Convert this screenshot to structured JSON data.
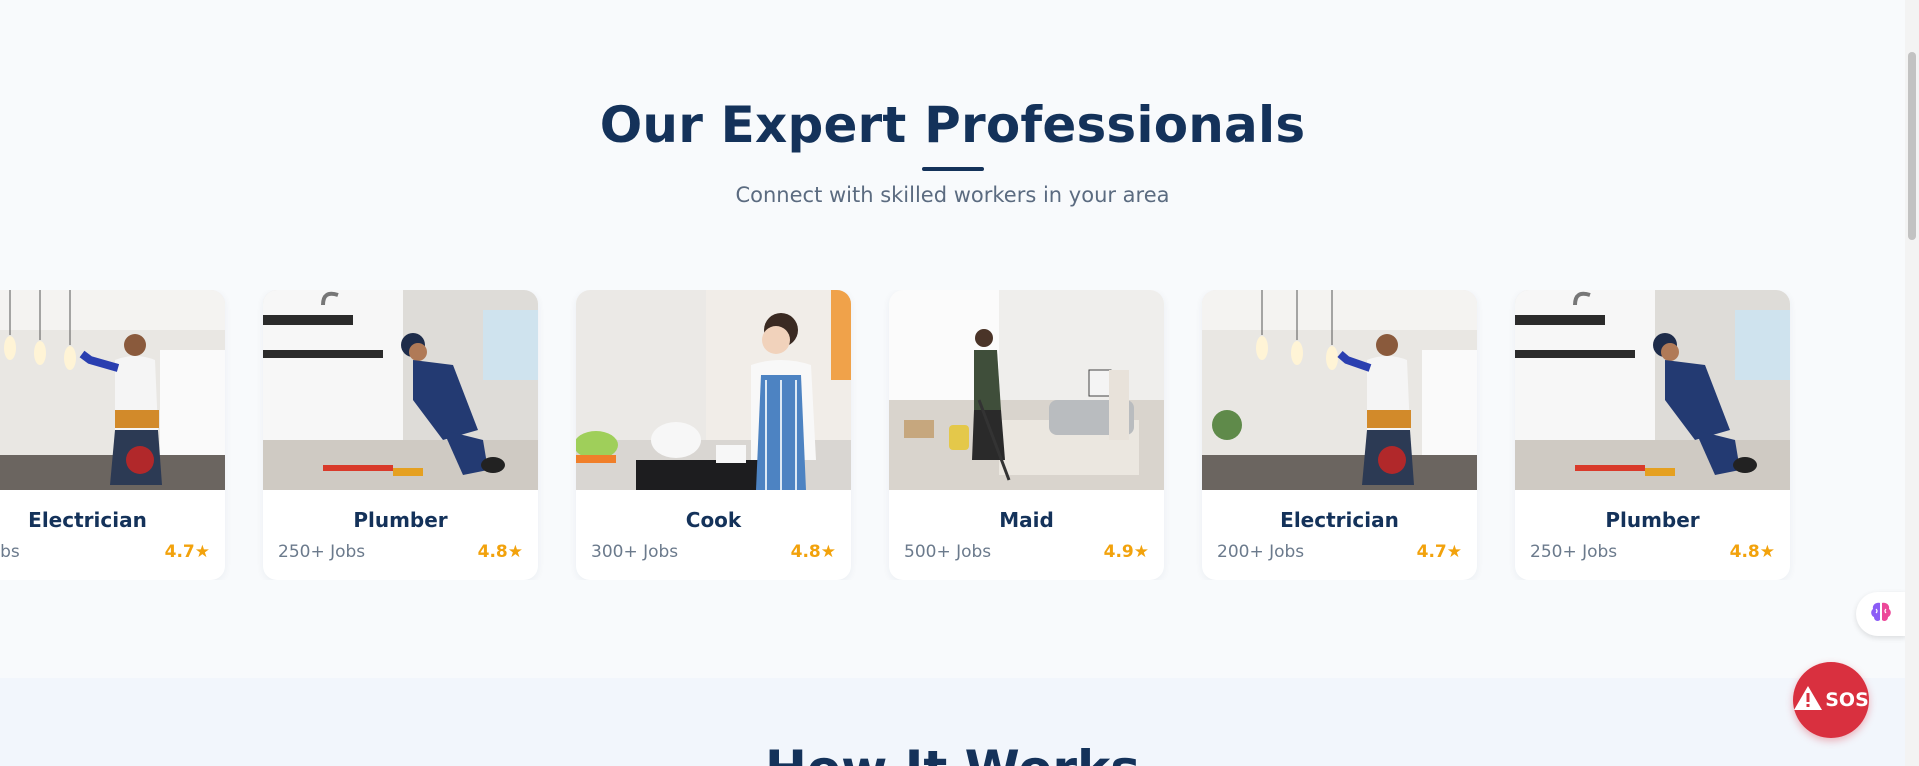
{
  "section": {
    "title": "Our Expert Professionals",
    "subtitle": "Connect with skilled workers in your area"
  },
  "cards": [
    {
      "title": "Electrician",
      "jobs": "+ Jobs",
      "rating": "4.7★",
      "image": "electrician-photo"
    },
    {
      "title": "Plumber",
      "jobs": "250+ Jobs",
      "rating": "4.8★",
      "image": "plumber-photo"
    },
    {
      "title": "Cook",
      "jobs": "300+ Jobs",
      "rating": "4.8★",
      "image": "cook-photo"
    },
    {
      "title": "Maid",
      "jobs": "500+ Jobs",
      "rating": "4.9★",
      "image": "maid-photo"
    },
    {
      "title": "Electrician",
      "jobs": "200+ Jobs",
      "rating": "4.7★",
      "image": "electrician-photo"
    },
    {
      "title": "Plumber",
      "jobs": "250+ Jobs",
      "rating": "4.8★",
      "image": "plumber-photo"
    }
  ],
  "next_section": {
    "title": "How It Works"
  },
  "floating": {
    "sos_label": "SOS",
    "sos_icon": "warning-icon",
    "assistant_icon": "brain-icon"
  },
  "colors": {
    "heading": "#14325a",
    "subtitle": "#5b6b80",
    "rating": "#f2a20c",
    "sos": "#d9303f"
  }
}
